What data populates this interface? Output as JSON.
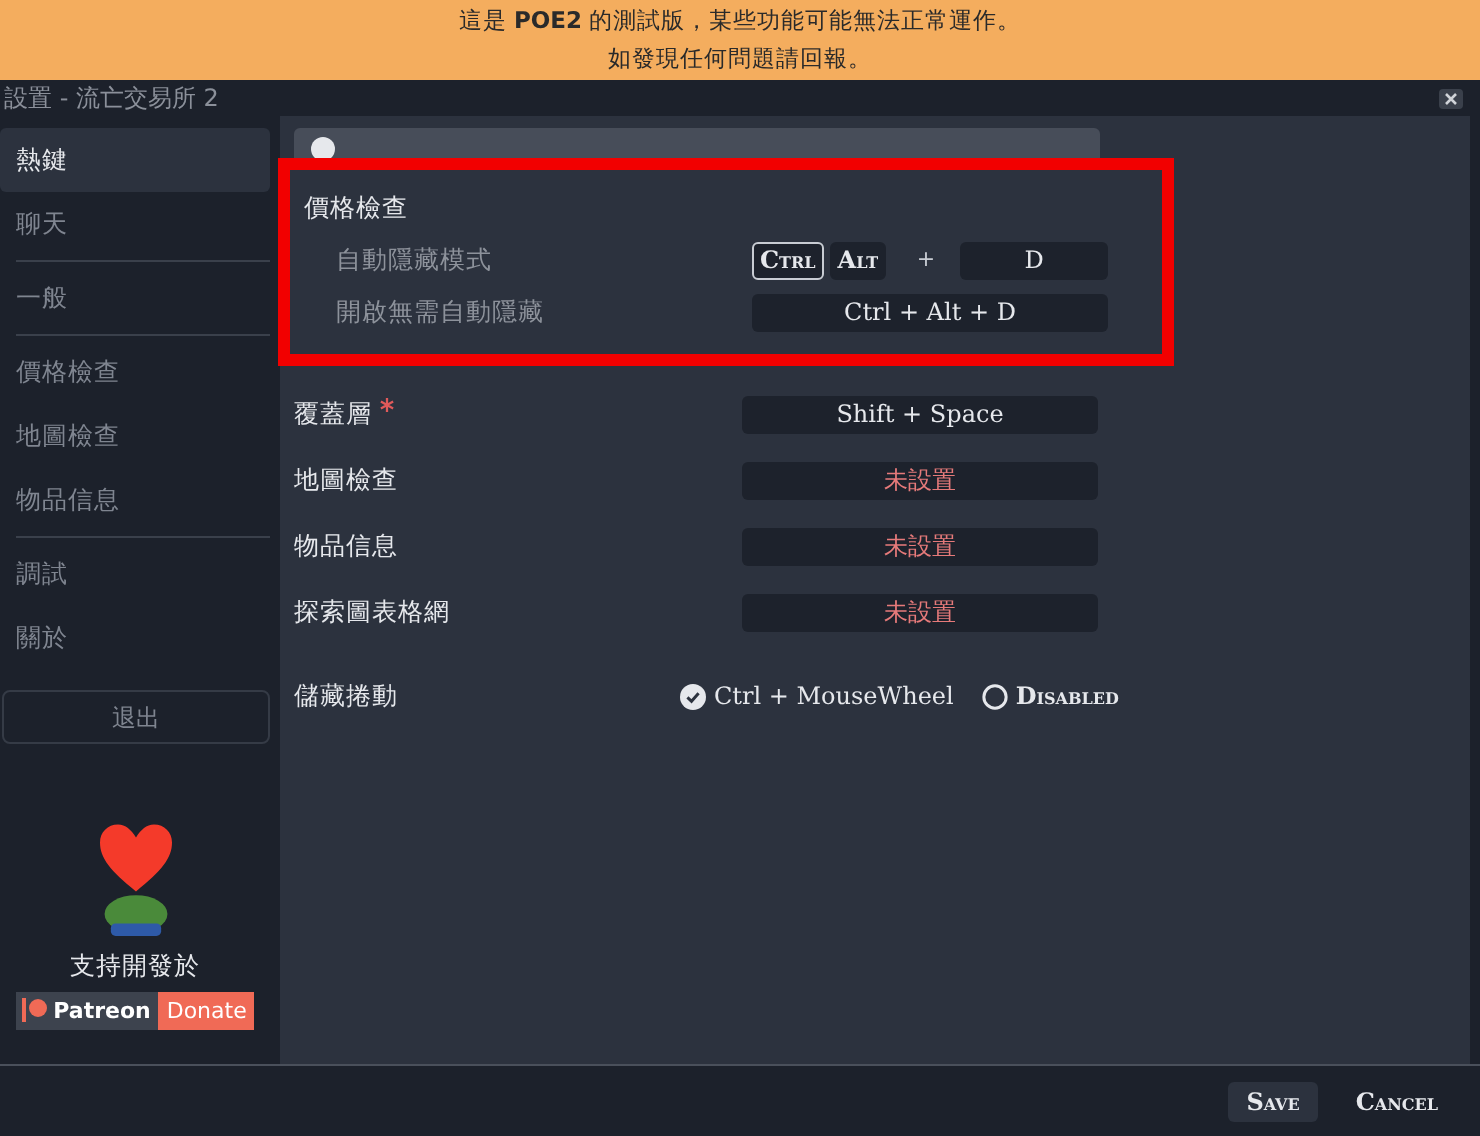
{
  "banner": {
    "lines": [
      "這是 **POE2** 的測試版，某些功能可能無法正常運作。",
      "如發現任何問題請回報。"
    ]
  },
  "window": {
    "title": "設置 - 流亡交易所 2"
  },
  "sidebar": {
    "groups": [
      [
        {
          "label": "熱鍵",
          "selected": true
        },
        {
          "label": "聊天",
          "selected": false
        }
      ],
      [
        {
          "label": "一般",
          "selected": false
        }
      ],
      [
        {
          "label": "價格檢查",
          "selected": false
        },
        {
          "label": "地圖檢查",
          "selected": false
        },
        {
          "label": "物品信息",
          "selected": false
        }
      ],
      [
        {
          "label": "調試",
          "selected": false
        },
        {
          "label": "關於",
          "selected": false
        }
      ]
    ],
    "exit_button": "退出",
    "support": {
      "text": "支持開發於",
      "patreon": "Patreon",
      "donate": "Donate"
    }
  },
  "price_check": {
    "title": "價格檢查",
    "rows": [
      {
        "kind": "combo",
        "label": "自動隱藏模式",
        "modifiers": [
          {
            "label": "Ctrl",
            "selected": true
          },
          {
            "label": "Alt",
            "selected": false
          }
        ],
        "plus": "+",
        "key": "D"
      },
      {
        "kind": "hotkey",
        "label": "開啟無需自動隱藏",
        "value": "Ctrl + Alt + D"
      }
    ]
  },
  "hotkeys": [
    {
      "label": "覆蓋層",
      "required": true,
      "value": "Shift + Space",
      "assigned": true
    },
    {
      "label": "地圖檢查",
      "required": false,
      "value": "未設置",
      "assigned": false
    },
    {
      "label": "物品信息",
      "required": false,
      "value": "未設置",
      "assigned": false
    },
    {
      "label": "探索圖表格網",
      "required": false,
      "value": "未設置",
      "assigned": false
    }
  ],
  "stash_scroll": {
    "label": "儲藏捲動",
    "options": [
      {
        "label": "Ctrl + MouseWheel",
        "selected": true
      },
      {
        "label": "Disabled",
        "selected": false
      }
    ]
  },
  "footer": {
    "buttons": [
      {
        "label": "Save",
        "kind": "filled"
      },
      {
        "label": "Cancel",
        "kind": "plain"
      }
    ]
  }
}
